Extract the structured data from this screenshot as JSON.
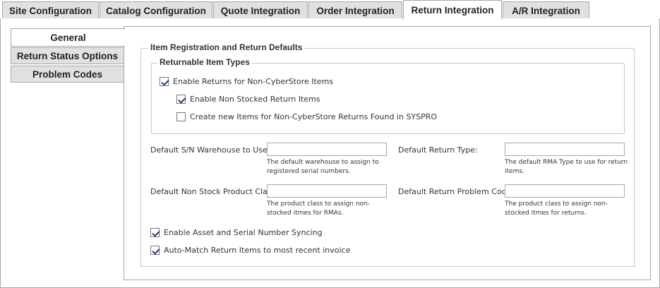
{
  "top_tabs": [
    {
      "label": "Site Configuration"
    },
    {
      "label": "Catalog Configuration"
    },
    {
      "label": "Quote Integration"
    },
    {
      "label": "Order Integration"
    },
    {
      "label": "Return Integration"
    },
    {
      "label": "A/R Integration"
    }
  ],
  "side_tabs": [
    {
      "label": "General"
    },
    {
      "label": "Return Status Options"
    },
    {
      "label": "Problem Codes"
    }
  ],
  "section": {
    "title": "Item Registration and Return Defaults",
    "returnable": {
      "title": "Returnable Item Types",
      "enable_returns": "Enable Returns for Non-CyberStore Items",
      "enable_non_stocked": "Enable Non Stocked Return Items",
      "create_new_items": "Create new Items for Non-CyberStore Returns Found in SYSPRO"
    },
    "fields": {
      "sn_warehouse_label": "Default S/N Warehouse to Use:",
      "sn_warehouse_value": "",
      "sn_warehouse_help": "The default warehouse to assign to registered serial numbers.",
      "return_type_label": "Default Return Type:",
      "return_type_value": "",
      "return_type_help": "The default RMA Type to use for return items.",
      "nonstock_class_label": "Default Non Stock Product Class:",
      "nonstock_class_value": "",
      "nonstock_class_help": "The product class to assign non-stocked itmes for RMAs.",
      "problem_code_label": "Default Return Problem Code:",
      "problem_code_value": "",
      "problem_code_help": "The product class to assign non-stocked itmes for returns."
    },
    "enable_asset_sync": "Enable Asset and Serial Number Syncing",
    "auto_match": "Auto-Match Return Items to most recent invoice"
  }
}
